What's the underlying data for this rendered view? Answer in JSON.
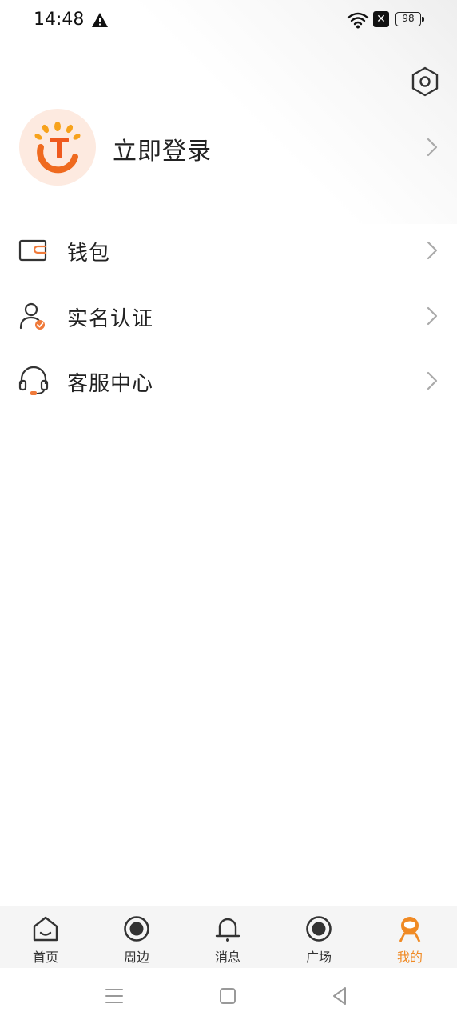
{
  "status_bar": {
    "time": "14:48",
    "battery": "98",
    "sim_icon": "sim-off-icon",
    "warning_icon": "warning-icon",
    "wifi_icon": "wifi-icon"
  },
  "header": {
    "settings_icon": "settings-hexagon-icon"
  },
  "profile": {
    "login_label": "立即登录",
    "avatar_icon": "app-logo-icon"
  },
  "menu": [
    {
      "label": "钱包",
      "icon": "wallet-icon"
    },
    {
      "label": "实名认证",
      "icon": "verified-user-icon"
    },
    {
      "label": "客服中心",
      "icon": "headset-icon"
    }
  ],
  "tabs": [
    {
      "label": "首页",
      "icon": "home-icon",
      "active": false
    },
    {
      "label": "周边",
      "icon": "nearby-icon",
      "active": false
    },
    {
      "label": "消息",
      "icon": "bell-icon",
      "active": false
    },
    {
      "label": "广场",
      "icon": "square-icon",
      "active": false
    },
    {
      "label": "我的",
      "icon": "profile-icon",
      "active": true
    }
  ],
  "colors": {
    "accent": "#f08a24",
    "avatar_bg": "#fdeae0",
    "tab_bar_bg": "#f5f5f5",
    "text": "#222222",
    "icon_orange": "#f07a3a"
  },
  "nav_bar": {
    "menu_icon": "menu-icon",
    "home_icon": "home-square-icon",
    "back_icon": "back-triangle-icon"
  }
}
